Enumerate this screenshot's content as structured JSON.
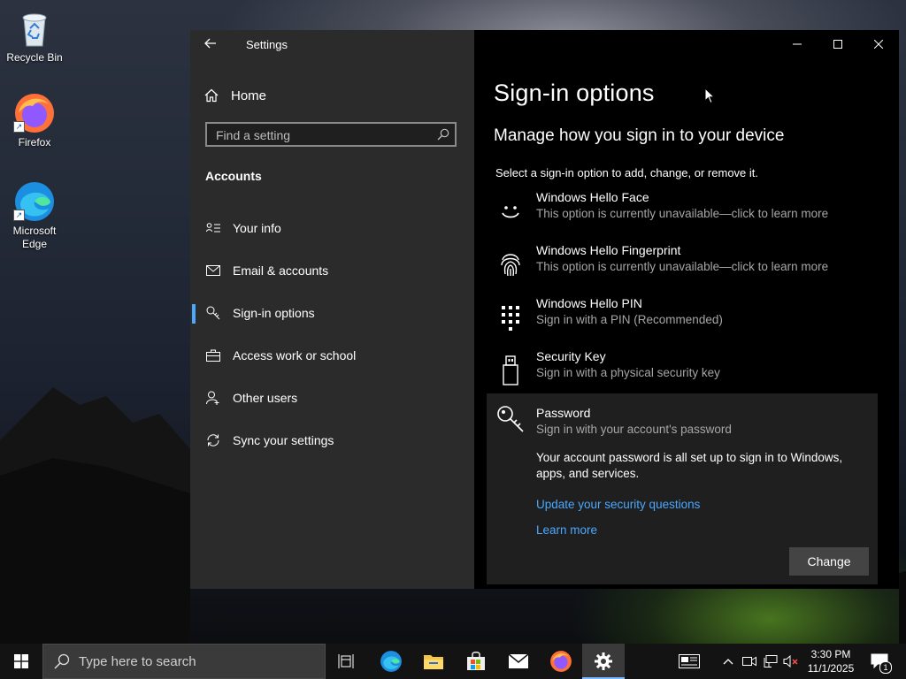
{
  "desktop": {
    "icons": [
      {
        "label": "Recycle Bin",
        "icon": "recycle-bin-icon"
      },
      {
        "label": "Firefox",
        "icon": "firefox-icon"
      },
      {
        "label": "Microsoft Edge",
        "icon": "edge-icon"
      }
    ]
  },
  "window": {
    "title": "Settings",
    "back_icon": "back-arrow-icon",
    "controls": [
      "minimize",
      "maximize",
      "close"
    ]
  },
  "nav": {
    "home_label": "Home",
    "search_placeholder": "Find a setting",
    "section": "Accounts",
    "items": [
      {
        "label": "Your info",
        "icon": "person-card-icon"
      },
      {
        "label": "Email & accounts",
        "icon": "mail-icon"
      },
      {
        "label": "Sign-in options",
        "icon": "key-icon",
        "active": true
      },
      {
        "label": "Access work or school",
        "icon": "briefcase-icon"
      },
      {
        "label": "Other users",
        "icon": "add-person-icon"
      },
      {
        "label": "Sync your settings",
        "icon": "sync-icon"
      }
    ],
    "accent": "#4aa8ff"
  },
  "content": {
    "title": "Sign-in options",
    "subtitle": "Manage how you sign in to your device",
    "instruction": "Select a sign-in option to add, change, or remove it.",
    "options": [
      {
        "name": "Windows Hello Face",
        "desc": "This option is currently unavailable—click to learn more",
        "icon": "face-icon"
      },
      {
        "name": "Windows Hello Fingerprint",
        "desc": "This option is currently unavailable—click to learn more",
        "icon": "fingerprint-icon"
      },
      {
        "name": "Windows Hello PIN",
        "desc": "Sign in with a PIN (Recommended)",
        "icon": "pin-keypad-icon"
      },
      {
        "name": "Security Key",
        "desc": "Sign in with a physical security key",
        "icon": "usb-key-icon"
      },
      {
        "name": "Password",
        "desc": "Sign in with your account's password",
        "icon": "password-key-icon"
      }
    ],
    "password_panel": {
      "message": "Your account password is all set up to sign in to Windows, apps, and services.",
      "link_security": "Update your security questions",
      "link_learn": "Learn more",
      "change_button": "Change"
    }
  },
  "taskbar": {
    "search_placeholder": "Type here to search",
    "apps": [
      "task-view-icon",
      "edge-icon",
      "file-explorer-icon",
      "store-icon",
      "mail-icon",
      "firefox-icon",
      "settings-icon"
    ],
    "time": "3:30 PM",
    "date": "11/1/2025",
    "notification_count": "1"
  }
}
